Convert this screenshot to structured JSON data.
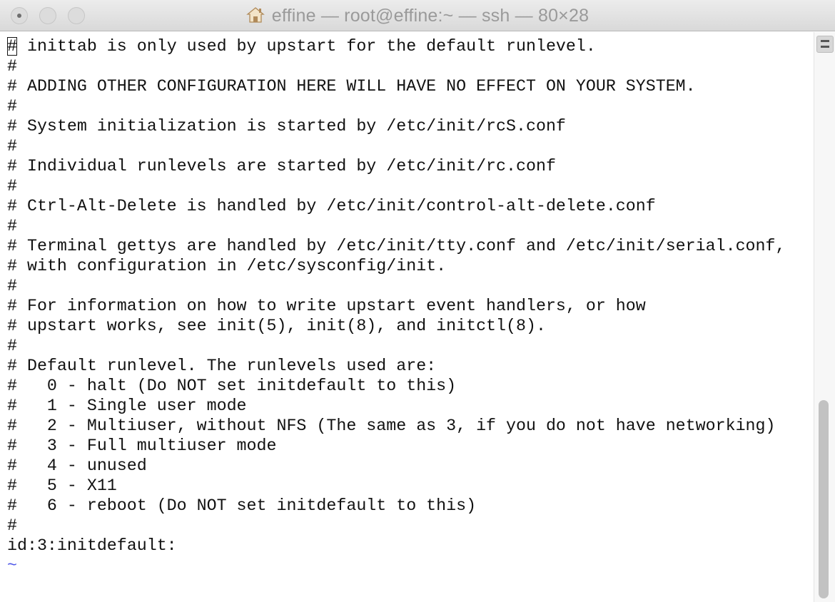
{
  "window": {
    "title": "effine — root@effine:~ — ssh — 80×28",
    "title_icon": "home-icon"
  },
  "terminal": {
    "lines": [
      "# inittab is only used by upstart for the default runlevel.",
      "#",
      "# ADDING OTHER CONFIGURATION HERE WILL HAVE NO EFFECT ON YOUR SYSTEM.",
      "#",
      "# System initialization is started by /etc/init/rcS.conf",
      "#",
      "# Individual runlevels are started by /etc/init/rc.conf",
      "#",
      "# Ctrl-Alt-Delete is handled by /etc/init/control-alt-delete.conf",
      "#",
      "# Terminal gettys are handled by /etc/init/tty.conf and /etc/init/serial.conf,",
      "# with configuration in /etc/sysconfig/init.",
      "#",
      "# For information on how to write upstart event handlers, or how",
      "# upstart works, see init(5), init(8), and initctl(8).",
      "#",
      "# Default runlevel. The runlevels used are:",
      "#   0 - halt (Do NOT set initdefault to this)",
      "#   1 - Single user mode",
      "#   2 - Multiuser, without NFS (The same as 3, if you do not have networking)",
      "#   3 - Full multiuser mode",
      "#   4 - unused",
      "#   5 - X11",
      "#   6 - reboot (Do NOT set initdefault to this)",
      "#",
      "id:3:initdefault:",
      "~"
    ],
    "empty_line_marker": "~"
  },
  "colors": {
    "text": "#111111",
    "tilde": "#4d56e8",
    "title_text": "#9a9a9a"
  }
}
